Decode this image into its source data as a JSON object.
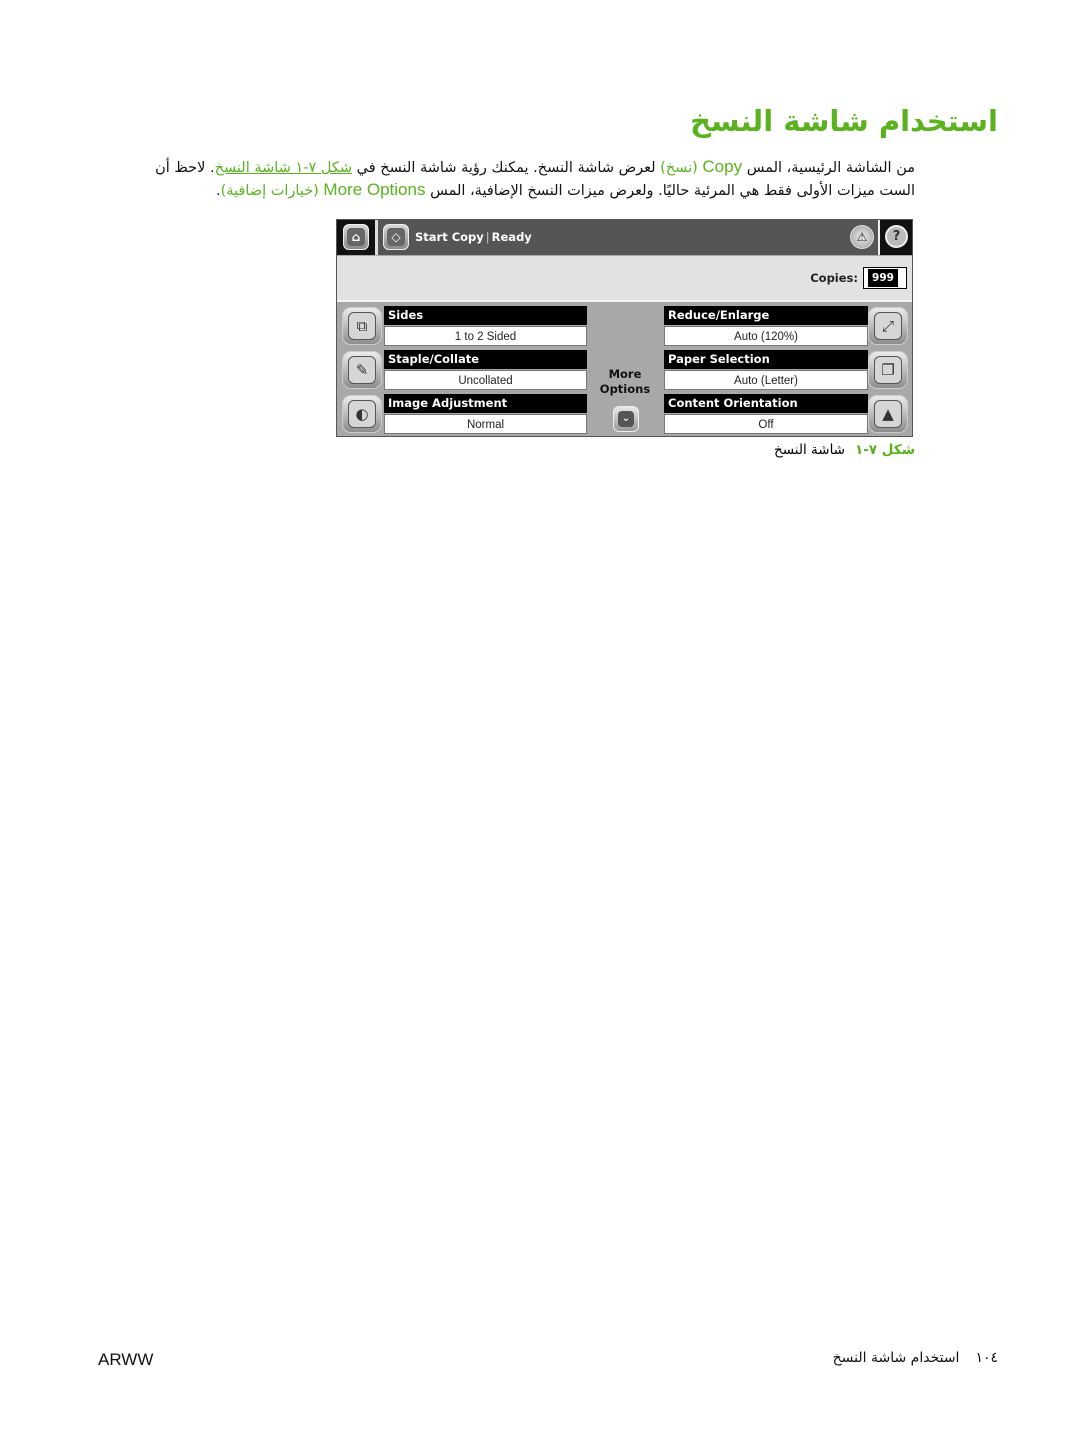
{
  "page": {
    "title": "استخدام شاشة النسخ",
    "paragraph": {
      "part1": "من الشاشة الرئيسية، المس ",
      "copy_en": "Copy",
      "copy_ar": "(نسخ)",
      "part2": " لعرض شاشة النسخ. يمكنك رؤية شاشة النسخ في ",
      "figure_link": "شكل ٧-١ شاشة النسخ",
      "part3": ". لاحظ أن الست ميزات الأولى فقط هي المرئية حاليًا. ولعرض ميزات النسخ الإضافية، المس ",
      "more_en": "More Options",
      "more_ar": "(خيارات إضافية)",
      "part4": "."
    },
    "figure_caption": {
      "number": "شكل ٧-١",
      "text": "شاشة النسخ"
    },
    "footer": {
      "left": "ARWW",
      "page_number": "١٠٤",
      "section": "استخدام شاشة النسخ"
    }
  },
  "device_screen": {
    "top_bar": {
      "home_icon": "home-icon",
      "start_icon": "start-diamond-icon",
      "start_label": "Start Copy",
      "status": "Ready",
      "warning_icon": "warning-icon",
      "help_icon": "help-icon"
    },
    "copies": {
      "label": "Copies:",
      "value": "999"
    },
    "left_options": [
      {
        "label": "Sides",
        "value": "1 to 2 Sided",
        "icon": "sides-icon"
      },
      {
        "label": "Staple/Collate",
        "value": "Uncollated",
        "icon": "staple-icon"
      },
      {
        "label": "Image Adjustment",
        "value": "Normal",
        "icon": "image-adjust-icon"
      }
    ],
    "right_options": [
      {
        "label": "Reduce/Enlarge",
        "value": "Auto (120%)",
        "icon": "reduce-enlarge-icon"
      },
      {
        "label": "Paper Selection",
        "value": "Auto (Letter)",
        "icon": "paper-icon"
      },
      {
        "label": "Content Orientation",
        "value": "Off",
        "icon": "orientation-icon"
      }
    ],
    "more_options": {
      "line1": "More",
      "line2": "Options",
      "icon": "chevron-down-icon"
    }
  },
  "colors": {
    "accent_green": "#5ab21f",
    "top_bar": "#555555",
    "panel_bg": "#a8a8a8"
  }
}
